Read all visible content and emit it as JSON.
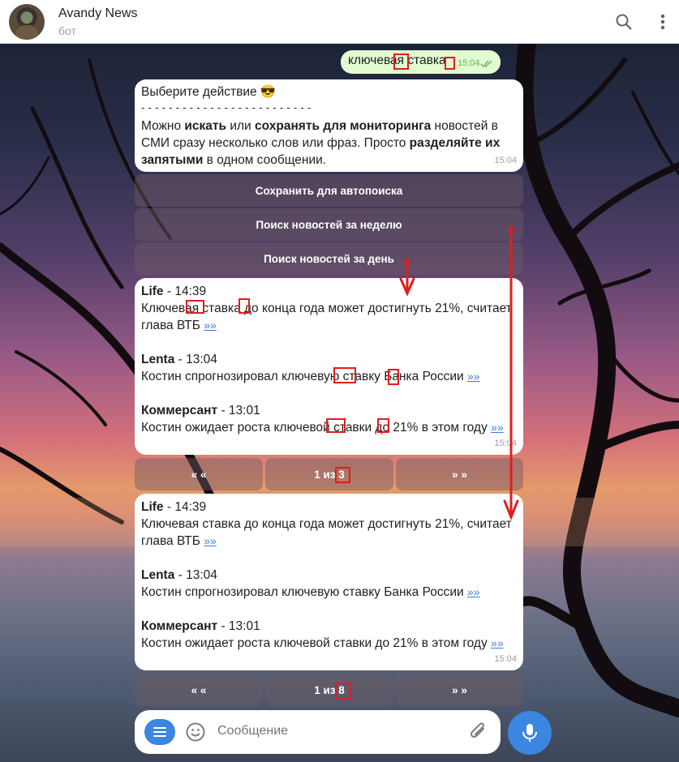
{
  "header": {
    "title": "Avandy News",
    "subtitle": "бот"
  },
  "outgoing": {
    "text": "ключевая ставка",
    "time": "15:04"
  },
  "action_message": {
    "title": "Выберите действие 😎",
    "divider": "- - - - - - - - - - - - - - - - - - - - - - - - -",
    "p1": "Можно ",
    "b1": "искать",
    "p2": " или ",
    "b2": "сохранять для мониторинга",
    "p3": " новостей в СМИ сразу несколько слов или фраз. Просто ",
    "b3": "разделяйте их запятыми",
    "p4": " в одном сообщении.",
    "time": "15:04"
  },
  "keyboard": {
    "save": "Сохранить для автопоиска",
    "week": "Поиск новостей за неделю",
    "day": "Поиск новостей за день"
  },
  "news_block_1": {
    "items": [
      {
        "source": "Life",
        "time": " - 14:39",
        "text": "Ключевая ставка до конца года может достигнуть 21%, считает глава ВТБ ",
        "more": "»»"
      },
      {
        "source": "Lenta",
        "time": " - 13:04",
        "text": "Костин спрогнозировал ключевую ставку Банка России ",
        "more": "»»"
      },
      {
        "source": "Коммерсант",
        "time": " - 13:01",
        "text": "Костин ожидает роста ключевой ставки до 21% в этом году ",
        "more": "»»"
      }
    ],
    "time": "15:04",
    "pager": {
      "prev": "« «",
      "label": "1 из 3",
      "next": "» »"
    }
  },
  "news_block_2": {
    "items": [
      {
        "source": "Life",
        "time": " - 14:39",
        "text": "Ключевая ставка до конца года может достигнуть 21%, считает глава ВТБ ",
        "more": "»»"
      },
      {
        "source": "Lenta",
        "time": " - 13:04",
        "text": "Костин спрогнозировал ключевую ставку Банка России ",
        "more": "»»"
      },
      {
        "source": "Коммерсант",
        "time": " - 13:01",
        "text": "Костин ожидает роста ключевой ставки до 21% в этом году ",
        "more": "»»"
      }
    ],
    "time": "15:04",
    "pager": {
      "prev": "« «",
      "label": "1 из 8",
      "next": "» »"
    }
  },
  "composer": {
    "placeholder": "Сообщение"
  },
  "colors": {
    "accent": "#3a86e0",
    "outgoing_bubble": "#e2fbd0",
    "annotation": "#e11d1d"
  },
  "icons": [
    "search-icon",
    "more-vert-icon",
    "menu-icon",
    "emoji-icon",
    "attach-icon",
    "mic-icon",
    "double-check-icon"
  ]
}
